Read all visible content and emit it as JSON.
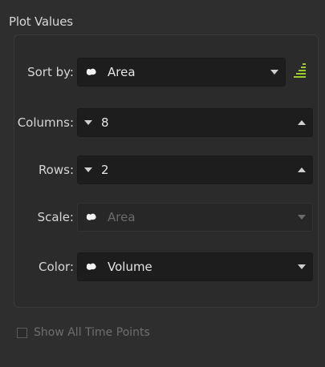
{
  "panel": {
    "title": "Plot Values",
    "accent_color": "#9ccc2c"
  },
  "sort_by": {
    "label": "Sort by:",
    "value": "Area",
    "lead_icon": "blob-icon",
    "trail_icon": "dropdown-arrow-icon",
    "sort_button_icon": "sort-ascending-icon"
  },
  "columns": {
    "label": "Columns:",
    "value": "8",
    "lead_icon": "decrement-arrow-icon",
    "trail_icon": "increment-arrow-icon"
  },
  "rows": {
    "label": "Rows:",
    "value": "2",
    "lead_icon": "decrement-arrow-icon",
    "trail_icon": "increment-arrow-icon"
  },
  "scale": {
    "label": "Scale:",
    "value": "Area",
    "enabled": false,
    "lead_icon": "blob-icon",
    "trail_icon": "dropdown-arrow-icon"
  },
  "color": {
    "label": "Color:",
    "value": "Volume",
    "lead_icon": "blob-icon",
    "trail_icon": "dropdown-arrow-icon"
  },
  "show_all_time_points": {
    "label": "Show All Time Points",
    "checked": false,
    "enabled": false
  }
}
